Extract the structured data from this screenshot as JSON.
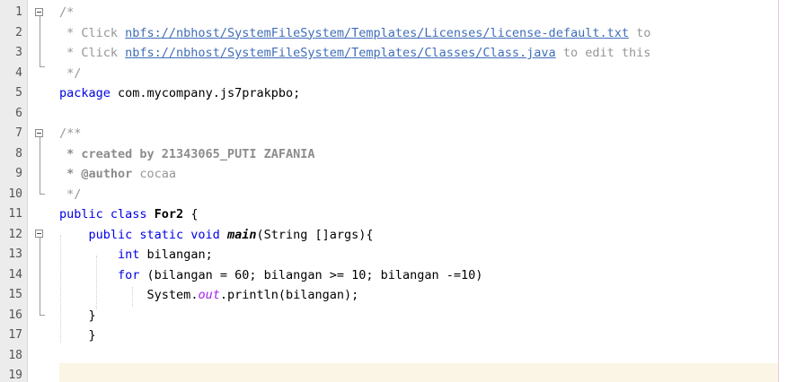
{
  "editor": {
    "line_numbers": [
      "1",
      "2",
      "3",
      "4",
      "5",
      "6",
      "7",
      "8",
      "9",
      "10",
      "11",
      "12",
      "13",
      "14",
      "15",
      "16",
      "17",
      "18",
      "19"
    ],
    "lines": {
      "l1": "/*",
      "l2_prefix": " * Click ",
      "l2_link": "nbfs://nbhost/SystemFileSystem/Templates/Licenses/license-default.txt",
      "l2_suffix": " to",
      "l3_prefix": " * Click ",
      "l3_link": "nbfs://nbhost/SystemFileSystem/Templates/Classes/Class.java",
      "l3_suffix": " to edit this",
      "l4": " */",
      "l5_kw": "package",
      "l5_rest": " com.mycompany.js7prakpbo;",
      "l7": "/**",
      "l8": " * created by 21343065_PUTI ZAFANIA",
      "l9_tag": " * @author",
      "l9_rest": " cocaa",
      "l10": " */",
      "l11_kw": "public class",
      "l11_name": " For2",
      "l11_rest": " {",
      "l12_indent": "    ",
      "l12_kw": "public static void",
      "l12_method": "main",
      "l12_rest": "(String []args){",
      "l13_indent": "        ",
      "l13_kw": "int",
      "l13_rest": " bilangan;",
      "l14_indent": "        ",
      "l14_kw": "for",
      "l14_rest": " (bilangan = 60; bilangan >= 10; bilangan -=10)",
      "l15_indent": "            ",
      "l15_obj": "System.",
      "l15_field": "out",
      "l15_rest": ".println(bilangan);",
      "l16": "    }",
      "l17": "    }"
    }
  }
}
